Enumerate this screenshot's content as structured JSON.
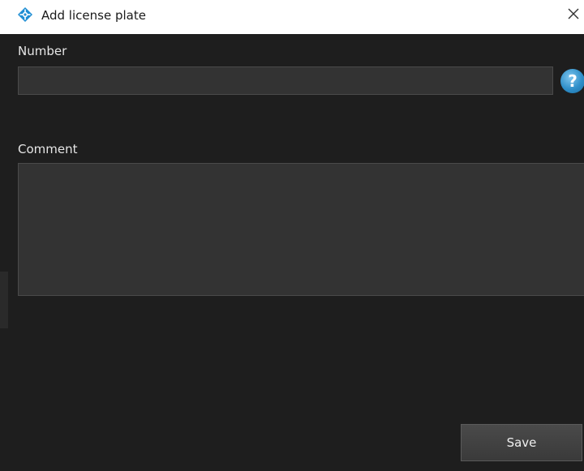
{
  "window": {
    "title": "Add license plate",
    "close_glyph": "✕"
  },
  "icons": {
    "app": "app-logo-icon",
    "help": "help-icon",
    "close": "close-icon"
  },
  "form": {
    "number_label": "Number",
    "number_value": "",
    "help_glyph": "?",
    "comment_label": "Comment",
    "comment_value": ""
  },
  "actions": {
    "save_label": "Save"
  },
  "colors": {
    "background": "#1e1e1e",
    "input_background": "#333333",
    "help_accent": "#2f8fc9",
    "app_icon_accent": "#1f8ed4"
  }
}
